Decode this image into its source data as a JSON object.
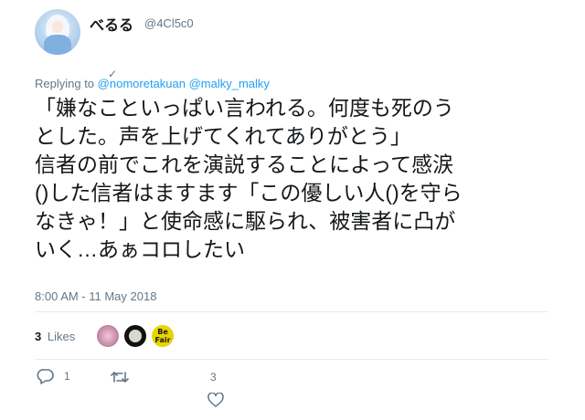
{
  "tweet": {
    "display_name": "べるる",
    "handle": "@4Cl5c0",
    "replying_to_prefix": "Replying to",
    "replying_to_mark": "✓",
    "replying_to_users": "@nomoretakuan @malky_malky",
    "text": "「嫌なこといっぱい言われる。何度も死のう\nとした。声を上げてくれてありがとう」\n信者の前でこれを演説することによって感涙\n()した信者はますます「この優しい人()を守ら\nなきゃ！」と使命感に駆られ、被害者に凸が\nいく…あぁコロしたい",
    "timestamp": "8:00 AM - 11 May 2018"
  },
  "stats": {
    "likes_count": "3",
    "likes_label": "Likes",
    "liker_c_badge": "Be\nFair"
  },
  "actions": {
    "reply_count": "1",
    "like_count": "3"
  },
  "icons": {
    "reply": "reply-icon",
    "retweet": "retweet-icon",
    "like": "heart-icon"
  },
  "colors": {
    "link": "#1da1f2",
    "secondary_text": "#657786",
    "primary_text": "#14171a",
    "divider": "#e6ecf0"
  }
}
